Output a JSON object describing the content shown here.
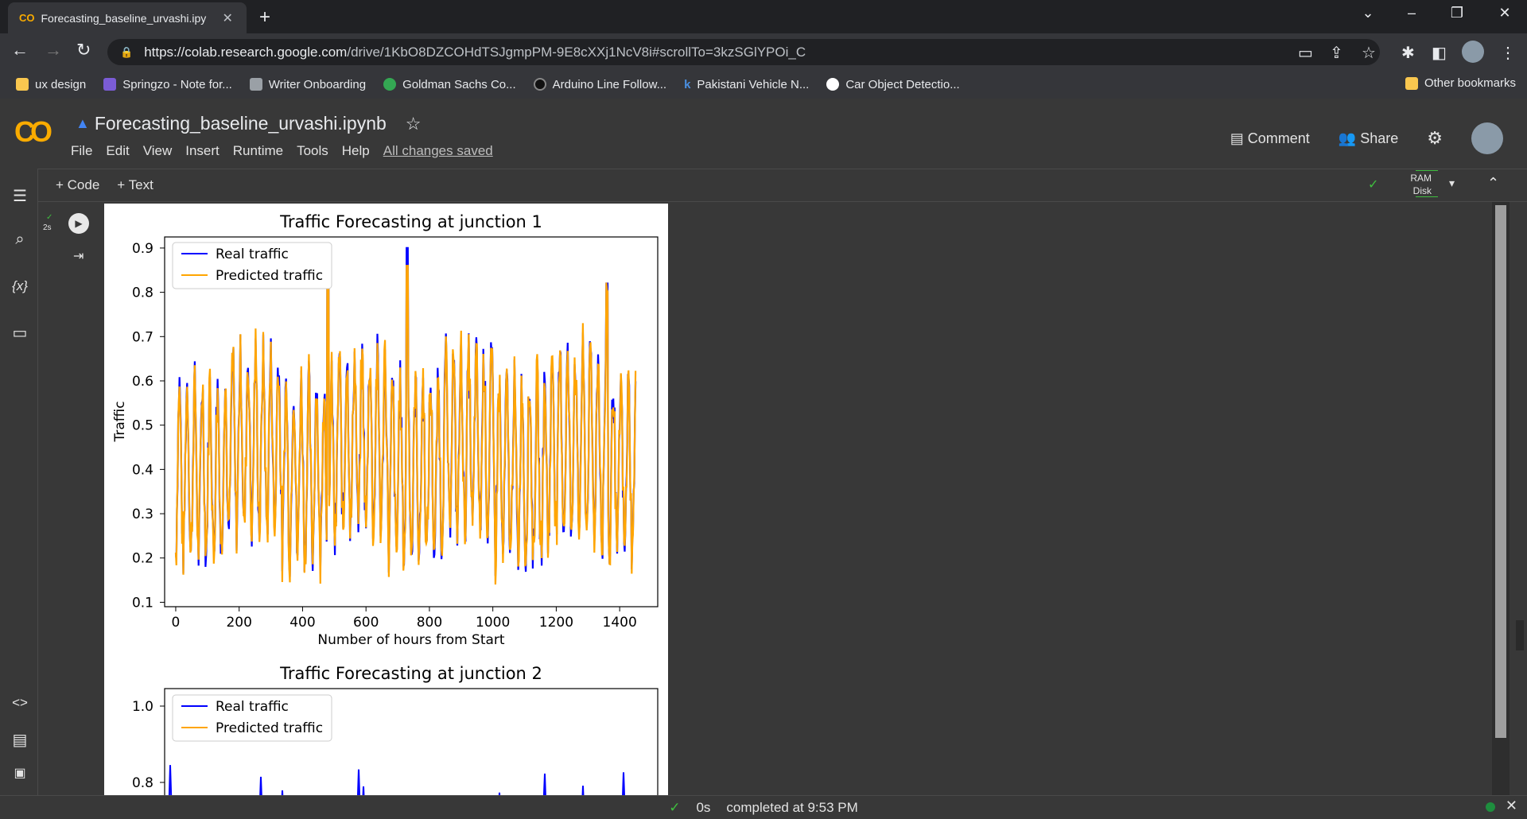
{
  "browser": {
    "tab_title": "Forecasting_baseline_urvashi.ipy",
    "tab_icon": "CO",
    "url_host": "https://colab.research.google.com",
    "url_path": "/drive/1KbO8DZCOHdTSJgmpPM-9E8cXXj1NcV8i#scrollTo=3kzSGlYPOi_C",
    "bookmarks": [
      {
        "label": "ux design",
        "color": "#f9c74f"
      },
      {
        "label": "Springzo - Note for...",
        "color": "#7b5cd6"
      },
      {
        "label": "Writer Onboarding",
        "color": "#9aa0a6"
      },
      {
        "label": "Goldman Sachs Co...",
        "color": "#34a853"
      },
      {
        "label": "Arduino Line Follow...",
        "color": "#202124"
      },
      {
        "label": "Pakistani Vehicle N...",
        "color": "#1a73e8"
      },
      {
        "label": "Car Object Detectio...",
        "color": "#ffffff"
      }
    ],
    "other_bookmarks": "Other bookmarks"
  },
  "colab": {
    "logo": "CO",
    "notebook_title": "Forecasting_baseline_urvashi.ipynb",
    "menu": [
      "File",
      "Edit",
      "View",
      "Insert",
      "Runtime",
      "Tools",
      "Help"
    ],
    "saved_status": "All changes saved",
    "comment": "Comment",
    "share": "Share",
    "add_code": "+ Code",
    "add_text": "+ Text",
    "ram": "RAM",
    "disk": "Disk",
    "cell_exec_time": "2s",
    "status_time": "0s",
    "status_text": "completed at 9:53 PM"
  },
  "chart_data": [
    {
      "type": "line",
      "title": "Traffic Forecasting at junction 1",
      "xlabel": "Number of hours from Start",
      "ylabel": "Traffic",
      "xticks": [
        "0",
        "200",
        "400",
        "600",
        "800",
        "1000",
        "1200",
        "1400"
      ],
      "yticks": [
        "0.1",
        "0.2",
        "0.3",
        "0.4",
        "0.5",
        "0.6",
        "0.7",
        "0.8",
        "0.9"
      ],
      "xlim": [
        -35,
        1520
      ],
      "ylim": [
        0.09,
        0.925
      ],
      "legend": "top-left",
      "series": [
        {
          "name": "Real traffic",
          "color": "#0000ff"
        },
        {
          "name": "Predicted traffic",
          "color": "#ffa500"
        }
      ],
      "x_range": [
        0,
        1450
      ],
      "baseline_low": 0.2,
      "peak_high": 0.6,
      "weekly_peaks": [
        {
          "x": 480,
          "y": 0.87
        },
        {
          "x": 730,
          "y": 0.9
        },
        {
          "x": 1360,
          "y": 0.82
        }
      ]
    },
    {
      "type": "line",
      "title": "Traffic Forecasting at junction 2",
      "yticks": [
        "0.8",
        "1.0"
      ],
      "legend": "top-left",
      "series": [
        {
          "name": "Real traffic",
          "color": "#0000ff"
        },
        {
          "name": "Predicted traffic",
          "color": "#ffa500"
        }
      ]
    }
  ]
}
